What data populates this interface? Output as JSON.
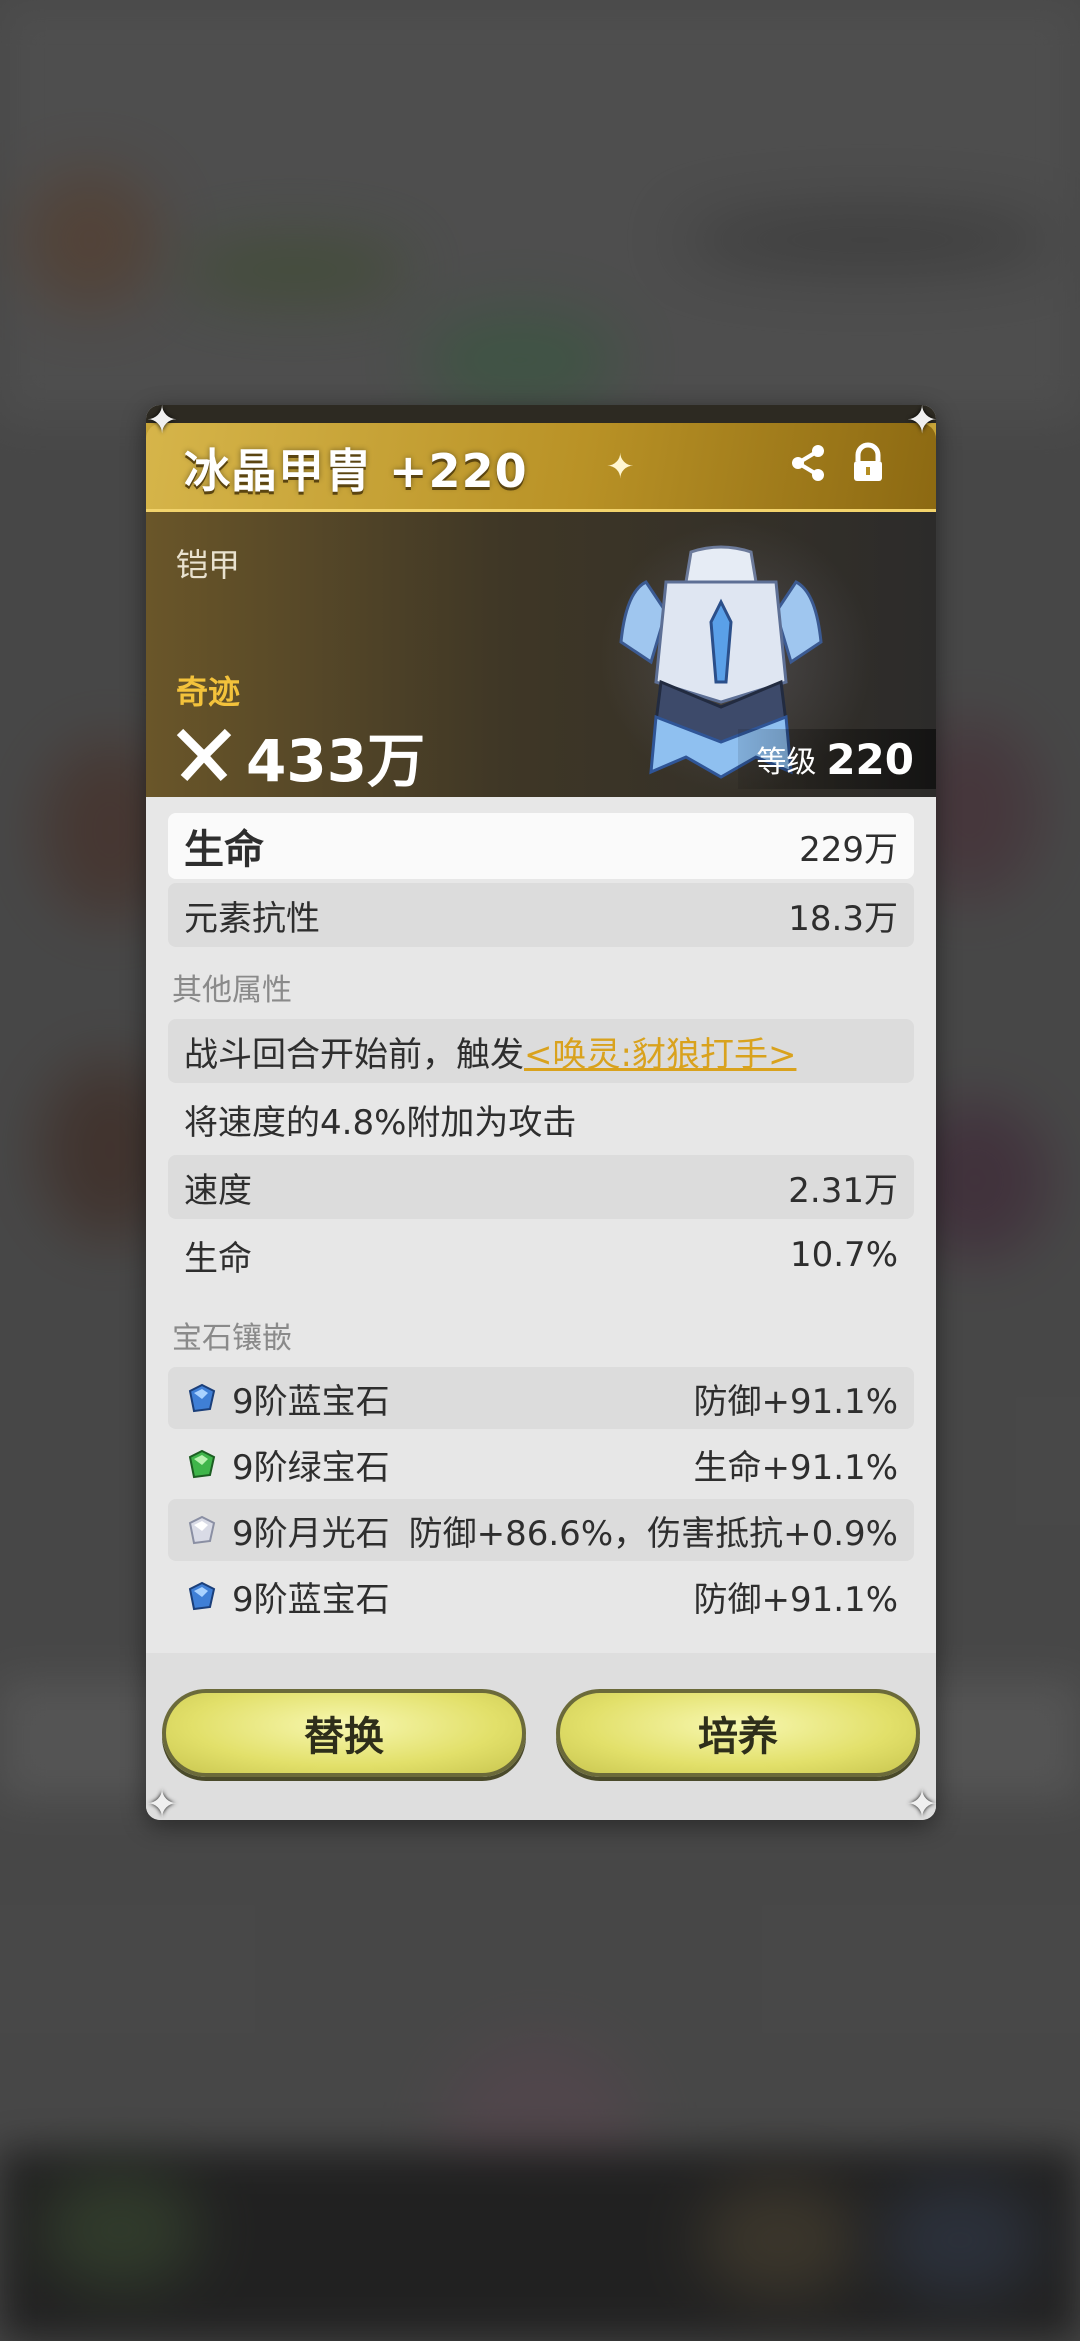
{
  "item": {
    "title": "冰晶甲胄 +220",
    "type": "铠甲",
    "rarity": "奇迹",
    "power": "433万",
    "level_label": "等级",
    "level_value": "220"
  },
  "main_stats": [
    {
      "label": "生命",
      "value": "229万"
    },
    {
      "label": "元素抗性",
      "value": "18.3万"
    }
  ],
  "other": {
    "section_title": "其他属性",
    "trigger_prefix": "战斗回合开始前，触发",
    "trigger_link": "<唤灵:豺狼打手>",
    "effect_text": "将速度的4.8%附加为攻击",
    "stats": [
      {
        "label": "速度",
        "value": "2.31万"
      },
      {
        "label": "生命",
        "value": "10.7%"
      }
    ]
  },
  "gems": {
    "section_title": "宝石镶嵌",
    "items": [
      {
        "name": "9阶蓝宝石",
        "effect": "防御+91.1%",
        "icon": "blue-gem-icon",
        "color": "#3f7fd6"
      },
      {
        "name": "9阶绿宝石",
        "effect": "生命+91.1%",
        "icon": "green-gem-icon",
        "color": "#3fb54a"
      },
      {
        "name": "9阶月光石",
        "effect": "防御+86.6%，伤害抵抗+0.9%",
        "icon": "moonstone-icon",
        "color": "#d9dbe6"
      },
      {
        "name": "9阶蓝宝石",
        "effect": "防御+91.1%",
        "icon": "blue-gem-icon",
        "color": "#3f7fd6"
      }
    ]
  },
  "buttons": {
    "replace": "替换",
    "upgrade": "培养"
  },
  "colors": {
    "gold": "#f3c23b",
    "link": "#d9a21d",
    "button": "#e2e06a"
  }
}
